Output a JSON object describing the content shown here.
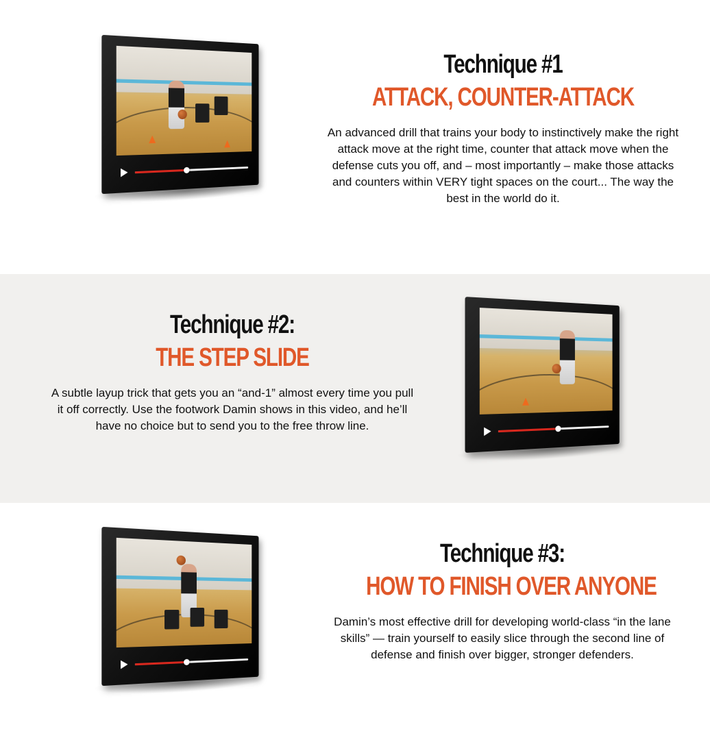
{
  "techniques": [
    {
      "label": "Technique #1",
      "name": "ATTACK, COUNTER-ATTACK",
      "description": "An advanced drill that trains your body to instinctively make the right attack move at the right time, counter that attack move when the defense cuts you off, and – most importantly – make those attacks and counters within VERY tight spaces on the court... The way the best in the world do it.",
      "video": {
        "progress": 0.43
      }
    },
    {
      "label": "Technique #2:",
      "name": "THE STEP SLIDE",
      "description": "A subtle layup trick that gets you an “and-1” almost every time you pull it off correctly. Use the footwork Damin shows in this video, and he’ll have no choice but to send you to the free throw line.",
      "video": {
        "progress": 0.52
      }
    },
    {
      "label": "Technique #3:",
      "name": "HOW TO FINISH OVER ANYONE",
      "description": "Damin’s most effective drill for developing world-class “in the lane skills” — train yourself to easily slice through the second line of defense and finish over bigger, stronger defenders.",
      "video": {
        "progress": 0.43
      }
    }
  ],
  "colors": {
    "accent": "#e0582a",
    "heading": "#111111",
    "alt_section_bg": "#f1f0ee",
    "progress_fill": "#d8281e"
  },
  "icons": {
    "play": "play-icon"
  }
}
